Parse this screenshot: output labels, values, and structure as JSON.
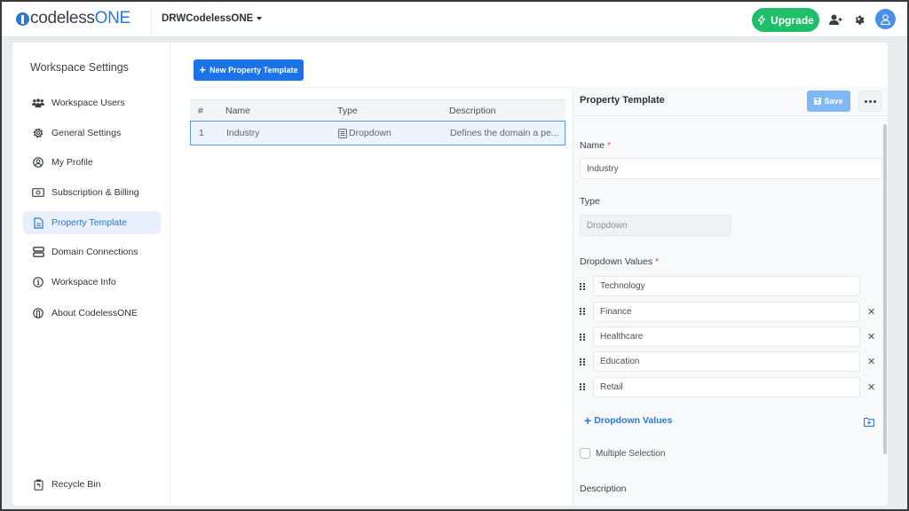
{
  "topbar": {
    "logo_text_main": "codeless",
    "logo_text_accent": "ONE",
    "workspace_name": "DRWCodelessONE",
    "upgrade_label": "Upgrade"
  },
  "sidebar": {
    "title": "Workspace Settings",
    "items": [
      {
        "label": "Workspace Users",
        "icon": "users-icon"
      },
      {
        "label": "General Settings",
        "icon": "gear-icon"
      },
      {
        "label": "My Profile",
        "icon": "user-circle-icon"
      },
      {
        "label": "Subscription & Billing",
        "icon": "money-bill-icon"
      },
      {
        "label": "Property Template",
        "icon": "file-icon",
        "active": true
      },
      {
        "label": "Domain Connections",
        "icon": "server-icon"
      },
      {
        "label": "Workspace Info",
        "icon": "info-icon"
      },
      {
        "label": "About CodelessONE",
        "icon": "codelessone-icon"
      }
    ],
    "recycle_bin": "Recycle Bin"
  },
  "main": {
    "new_button": "New Property Template",
    "table": {
      "columns": [
        "#",
        "Name",
        "Type",
        "Description"
      ],
      "rows": [
        {
          "num": "1",
          "name": "Industry",
          "type": "Dropdown",
          "description": "Defines the domain a pe..."
        }
      ]
    }
  },
  "panel": {
    "title": "Property Template",
    "save_label": "Save",
    "name_label": "Name",
    "name_value": "Industry",
    "type_label": "Type",
    "type_value": "Dropdown",
    "dropdown_values_label": "Dropdown Values",
    "dropdown_values": [
      "Technology",
      "Finance",
      "Healthcare",
      "Education",
      "Retail"
    ],
    "add_values_label": "Dropdown Values",
    "multiple_selection_label": "Multiple Selection",
    "multiple_selection_checked": false,
    "description_label": "Description",
    "required_mark": "*"
  },
  "colors": {
    "primary": "#1a73e8",
    "upgrade": "#1fbf6a",
    "active_nav_bg": "#e8f0fb",
    "required": "#e04848"
  }
}
